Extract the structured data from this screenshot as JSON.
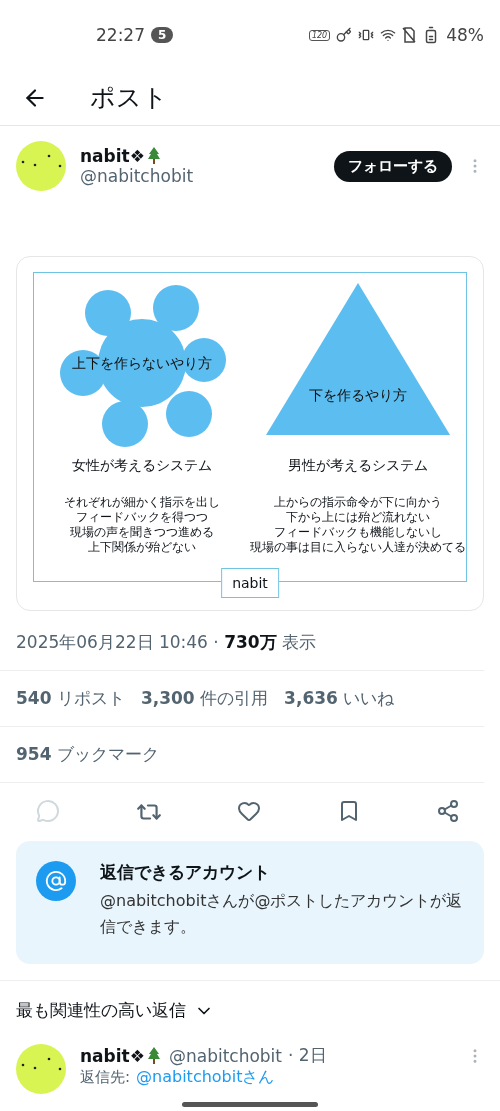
{
  "status_bar": {
    "time": "22:27",
    "notification_count": "5",
    "refresh_rate": "120",
    "battery": "48%"
  },
  "header": {
    "title": "ポスト"
  },
  "author": {
    "name": "nabit❖",
    "handle": "@nabitchobit",
    "follow_button": "フォローする"
  },
  "diagram": {
    "columns": [
      {
        "kind": "cluster",
        "shape_label": "上下を作らないやり方",
        "heading": "女性が考えるシステム",
        "lines": [
          "それぞれが細かく指示を出し",
          "フィードバックを得つつ",
          "現場の声を聞きつつ進める",
          "上下関係が殆どない"
        ]
      },
      {
        "kind": "triangle",
        "shape_label": "下を作るやり方",
        "heading": "男性が考えるシステム",
        "lines": [
          "上からの指示命令が下に向かう",
          "下から上には殆ど流れない",
          "フィードバックも機能しないし",
          "現場の事は目に入らない人達が決めてる"
        ]
      }
    ],
    "caption": "nabit"
  },
  "timestamp": "2025年06月22日 10:46 · **730万** 表示",
  "stats": [
    "**540** リポスト",
    "**3,300** 件の引用",
    "**3,636** いいね"
  ],
  "bookmarks": "**954** ブックマーク",
  "actions": [
    {
      "kind": "reply",
      "disabled": true
    },
    {
      "kind": "repost",
      "disabled": false
    },
    {
      "kind": "like",
      "disabled": false
    },
    {
      "kind": "bookmark",
      "disabled": false
    },
    {
      "kind": "share",
      "disabled": false
    }
  ],
  "reply_notice": {
    "title": "返信できるアカウント",
    "text": "@nabitchobitさんが@ポストしたアカウントが返信できます。"
  },
  "sort": {
    "label": "最も関連性の高い返信"
  },
  "replies": [
    {
      "name": "nabit❖",
      "handle": "@nabitchobit",
      "time": "· 2日",
      "reply_to_label": "返信先:",
      "reply_to": "@nabitchobitさん"
    }
  ]
}
